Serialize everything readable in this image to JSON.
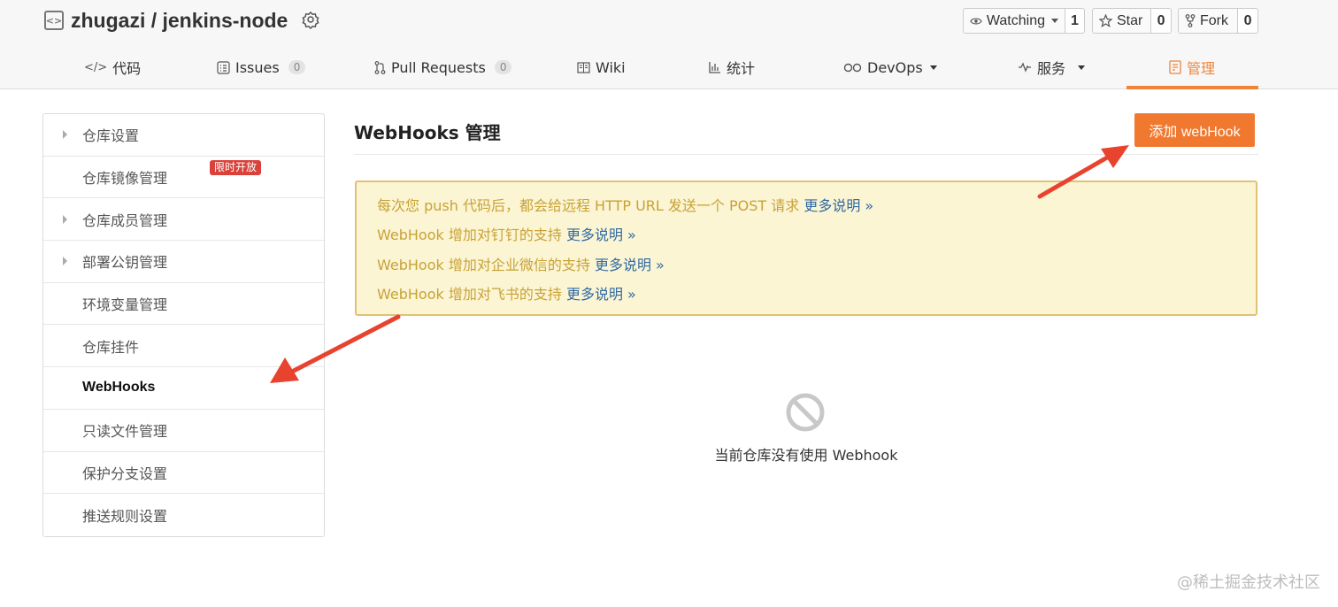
{
  "header": {
    "repo_name": "zhugazi / jenkins-node",
    "watching": {
      "label": "Watching",
      "count": "1"
    },
    "star": {
      "label": "Star",
      "count": "0"
    },
    "fork": {
      "label": "Fork",
      "count": "0"
    }
  },
  "nav": {
    "code": "代码",
    "issues": "Issues",
    "issues_count": "0",
    "pull_requests": "Pull Requests",
    "pull_requests_count": "0",
    "wiki": "Wiki",
    "stats": "统计",
    "devops": "DevOps",
    "services": "服务",
    "manage": "管理"
  },
  "sidebar": {
    "items": [
      {
        "label": "仓库设置"
      },
      {
        "label": "仓库镜像管理",
        "badge": "限时开放"
      },
      {
        "label": "仓库成员管理"
      },
      {
        "label": "部署公钥管理"
      },
      {
        "label": "环境变量管理"
      },
      {
        "label": "仓库挂件"
      },
      {
        "label": "WebHooks"
      },
      {
        "label": "只读文件管理"
      },
      {
        "label": "保护分支设置"
      },
      {
        "label": "推送规则设置"
      }
    ]
  },
  "main": {
    "title": "WebHooks 管理",
    "add_button": "添加 webHook",
    "notices": [
      {
        "text": "每次您 push 代码后，都会给远程 HTTP URL 发送一个 POST 请求 ",
        "link": "更多说明 »"
      },
      {
        "text": "WebHook 增加对钉钉的支持 ",
        "link": "更多说明 »"
      },
      {
        "text": "WebHook 增加对企业微信的支持 ",
        "link": "更多说明 »"
      },
      {
        "text": "WebHook 增加对飞书的支持 ",
        "link": "更多说明 »"
      }
    ],
    "empty_text": "当前仓库没有使用 Webhook"
  },
  "watermark": "@稀土掘金技术社区",
  "colors": {
    "accent": "#f0843a",
    "button": "#f0792f",
    "notice_bg": "#fcf5d4",
    "notice_text": "#c7a236",
    "link": "#2f6aa3",
    "badge": "#d9423a",
    "arrow": "#e8432f"
  }
}
